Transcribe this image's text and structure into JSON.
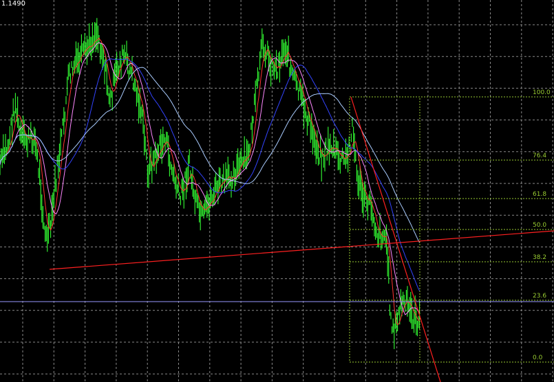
{
  "chart_data": {
    "type": "line",
    "price_label": "1.1490",
    "background": "#000000",
    "grid": {
      "on": true,
      "color": "#8a8a8a",
      "style": "dashed"
    },
    "candle_color": "#33ff33",
    "fibonacci": {
      "color": "#9acd32",
      "levels": [
        "100.0",
        "76.4",
        "61.8",
        "50.0",
        "38.2",
        "23.6",
        "0.0"
      ]
    },
    "trendline_color": "#ff2020",
    "horizontal_line_color": "#9999ff",
    "ma_colors": {
      "fast": "#ff3333",
      "medium": "#ff88ff",
      "slow": "#3344ff",
      "slowest": "#aaccff"
    }
  }
}
